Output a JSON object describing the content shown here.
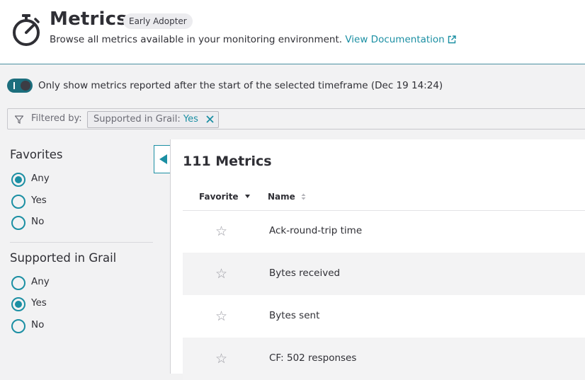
{
  "header": {
    "title": "Metrics",
    "badge": "Early Adopter",
    "subtitle": "Browse all metrics available in your monitoring environment.",
    "doc_link": "View Documentation",
    "logo_icon": "stopwatch-icon"
  },
  "timeframe_toggle": {
    "on": true,
    "label": "Only show metrics reported after the start of the selected timeframe (Dec 19 14:24)"
  },
  "filter": {
    "label": "Filtered by:",
    "chip_key": "Supported in Grail:",
    "chip_value": "Yes"
  },
  "sidebar": {
    "favorites": {
      "title": "Favorites",
      "options": [
        "Any",
        "Yes",
        "No"
      ],
      "selected": "Any"
    },
    "grail": {
      "title": "Supported in Grail",
      "options": [
        "Any",
        "Yes",
        "No"
      ],
      "selected": "Yes"
    }
  },
  "table": {
    "count": "111 Metrics",
    "columns": {
      "favorite": "Favorite",
      "name": "Name"
    },
    "rows": [
      {
        "name": "Ack-round-trip time"
      },
      {
        "name": "Bytes received"
      },
      {
        "name": "Bytes sent"
      },
      {
        "name": "CF: 502 responses"
      }
    ]
  },
  "colors": {
    "accent": "#1b8fa3",
    "toggle": "#1c6e7d",
    "text": "#2f2f35",
    "background": "#f2f2f3"
  }
}
